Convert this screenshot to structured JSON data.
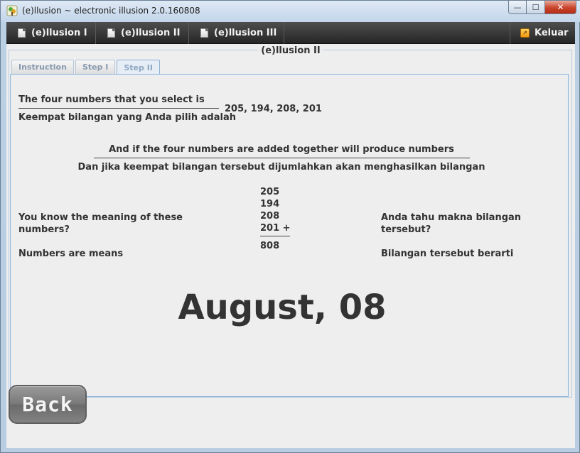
{
  "window": {
    "title": "(e)llusion ~ electronic illusion 2.0.160808",
    "minimize_glyph": "—",
    "maximize_glyph": "☐",
    "close_glyph": "✕"
  },
  "menu": {
    "items": [
      "(e)llusion I",
      "(e)llusion II",
      "(e)llusion III"
    ],
    "exit_label": "Keluar",
    "exit_icon_glyph": "↗"
  },
  "panel": {
    "title": "(e)llusion II",
    "tabs": [
      "Instruction",
      "Step I",
      "Step II"
    ],
    "active_tab": "Step II"
  },
  "content": {
    "selected_en": "The four numbers that you select is",
    "selected_id": "Keempat bilangan yang Anda pilih adalah",
    "selected_numbers": "205, 194, 208, 201",
    "added_en": "And if the four numbers are added together will produce numbers",
    "added_id": "Dan jika keempat bilangan tersebut dijumlahkan akan menghasilkan bilangan",
    "sum_lines": [
      "205",
      "194",
      "208",
      "201 +"
    ],
    "sum_total": "808",
    "meaning_en_line1": "You know the meaning of these",
    "meaning_en_line2": "numbers?",
    "means_en": "Numbers are means",
    "meaning_id_line1": "Anda tahu makna bilangan",
    "meaning_id_line2": "tersebut?",
    "means_id": "Bilangan tersebut berarti",
    "result": "August, 08"
  },
  "back_button_label": "Back"
}
